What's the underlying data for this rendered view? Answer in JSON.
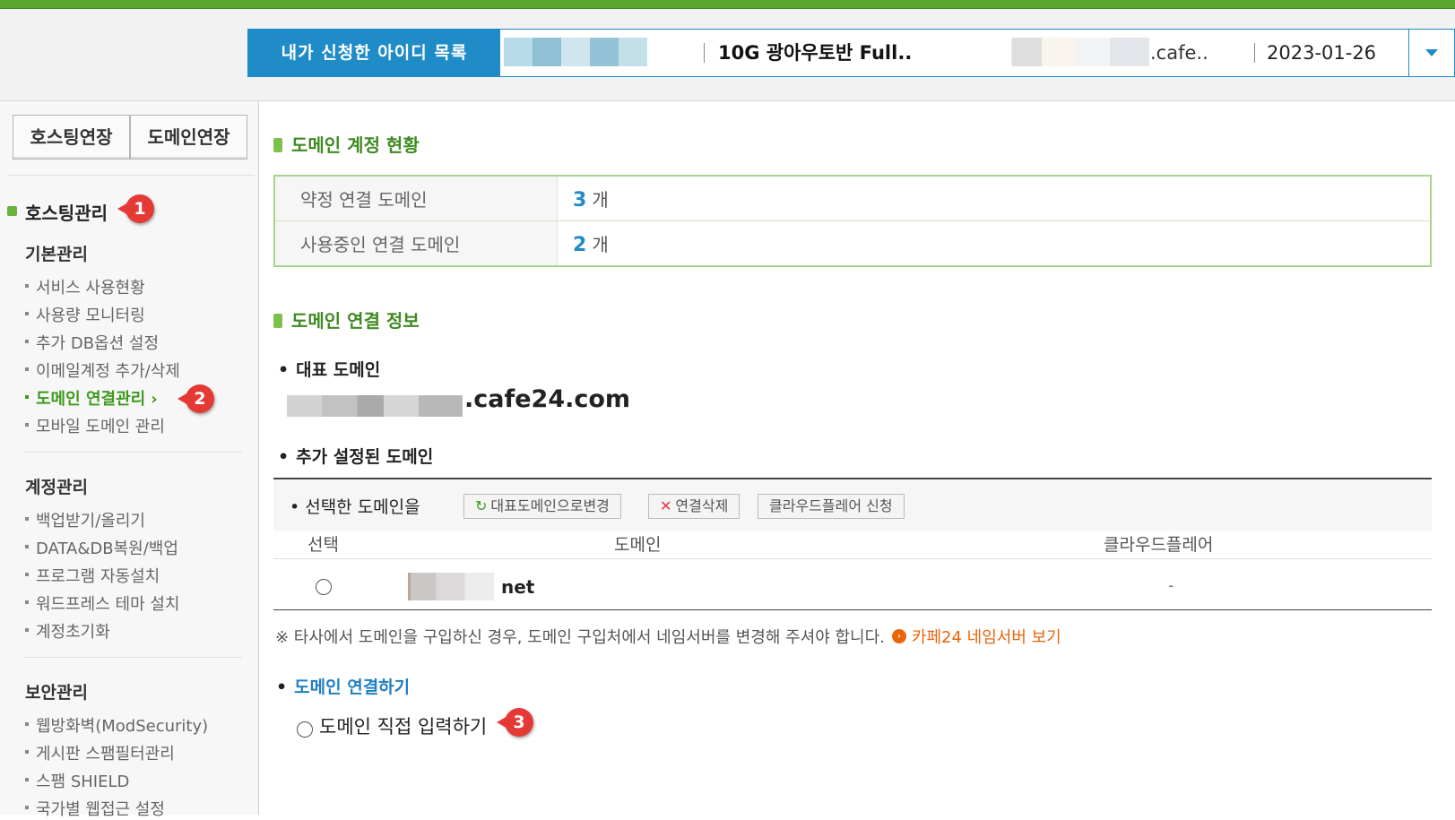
{
  "header": {
    "id_list_label": "내가 신청한 아이디 목록",
    "plan_name": "10G 광아우토반 Full..",
    "domain_suffix": ".cafe..",
    "date": "2023-01-26"
  },
  "sidebar": {
    "extend_hosting": "호스팅연장",
    "extend_domain": "도메인연장",
    "section_title": "호스팅관리",
    "groups": [
      {
        "title": "기본관리",
        "items": [
          "서비스 사용현황",
          "사용량 모니터링",
          "추가 DB옵션 설정",
          "이메일계정 추가/삭제",
          "도메인 연결관리",
          "모바일 도메인 관리"
        ]
      },
      {
        "title": "계정관리",
        "items": [
          "백업받기/올리기",
          "DATA&DB복원/백업",
          "프로그램 자동설치",
          "워드프레스 테마 설치",
          "계정초기화"
        ]
      },
      {
        "title": "보안관리",
        "items": [
          "웹방화벽(ModSecurity)",
          "게시판 스팸필터관리",
          "스팸 SHIELD",
          "국가별 웹접근 설정"
        ]
      }
    ]
  },
  "annotations": {
    "badge1": "1",
    "badge2": "2",
    "badge3": "3"
  },
  "main": {
    "status_title": "도메인 계정 현황",
    "stats": [
      {
        "label": "약정 연결 도메인",
        "value": "3",
        "unit": "개"
      },
      {
        "label": "사용중인 연결 도메인",
        "value": "2",
        "unit": "개"
      }
    ],
    "info_title": "도메인 연결 정보",
    "rep_domain_label": "대표 도메인",
    "rep_domain_value": ".cafe24.com",
    "added_domains_label": "추가 설정된 도메인",
    "selected_label": "선택한 도메인을",
    "btn_set_rep": "대표도메인으로변경",
    "btn_delete": "연결삭제",
    "btn_cloudflare": "클라우드플레어 신청",
    "columns": [
      "선택",
      "도메인",
      "클라우드플레어"
    ],
    "rows": [
      {
        "domain": "net",
        "cloudflare": "-"
      }
    ],
    "note": "※ 타사에서 도메인을 구입하신 경우, 도메인 구입처에서 네임서버를 변경해 주셔야 합니다.",
    "note_link": "카페24 네임서버 보기",
    "connect_title": "도메인 연결하기",
    "direct_input_label": "도메인 직접 입력하기"
  }
}
